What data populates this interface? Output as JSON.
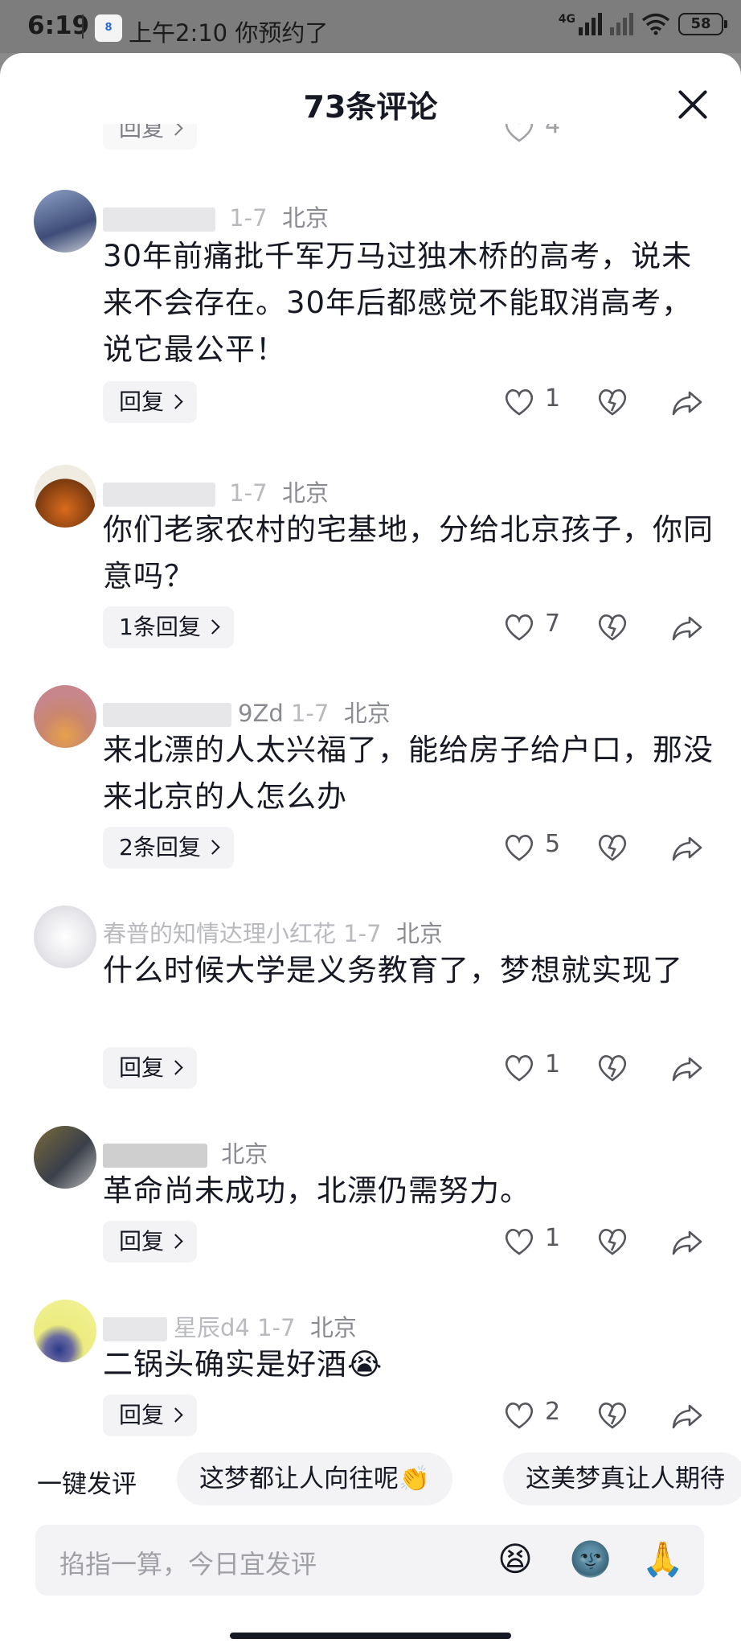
{
  "status_bar": {
    "time": "6:19",
    "app_icon_text": "8",
    "notice": "上午2:10 你预约了",
    "network": "4G",
    "battery": "58"
  },
  "sheet": {
    "title": "73条评论",
    "partial_row": {
      "reply_label": "回复",
      "like_count": "4"
    }
  },
  "comments": [
    {
      "user_visible": "",
      "date": "1-7",
      "location": "北京",
      "text": "30年前痛批千军万马过独木桥的高考，说未来不会存在。30年后都感觉不能取消高考，说它最公平！",
      "reply_label": "回复",
      "like_count": "1"
    },
    {
      "user_visible": "",
      "date": "1-7",
      "location": "北京",
      "text": "你们老家农村的宅基地，分给北京孩子，你同意吗？",
      "reply_label": "1条回复",
      "like_count": "7"
    },
    {
      "user_visible": "9Zd",
      "date": "1-7",
      "location": "北京",
      "text": "来北漂的人太兴福了，能给房子给户口，那没来北京的人怎么办",
      "reply_label": "2条回复",
      "like_count": "5"
    },
    {
      "user_visible": "春普的知情达理小红花",
      "date": "1-7",
      "location": "北京",
      "text": "什么时候大学是义务教育了，梦想就实现了",
      "reply_label": "回复",
      "like_count": "1"
    },
    {
      "user_visible": "",
      "date": "",
      "location": "北京",
      "text": "革命尚未成功，北漂仍需努力。",
      "reply_label": "回复",
      "like_count": "1"
    },
    {
      "user_visible": "星辰d4",
      "date": "1-7",
      "location": "北京",
      "text": "二锅头确实是好酒😭",
      "reply_label": "回复",
      "like_count": "2"
    }
  ],
  "quick_comment": {
    "label": "一键发评",
    "chips": [
      "这梦都让人向往呢👏",
      "这美梦真让人期待"
    ]
  },
  "input": {
    "placeholder": "掐指一算，今日宜发评",
    "emojis": [
      "😫",
      "🌚",
      "🙏"
    ]
  }
}
